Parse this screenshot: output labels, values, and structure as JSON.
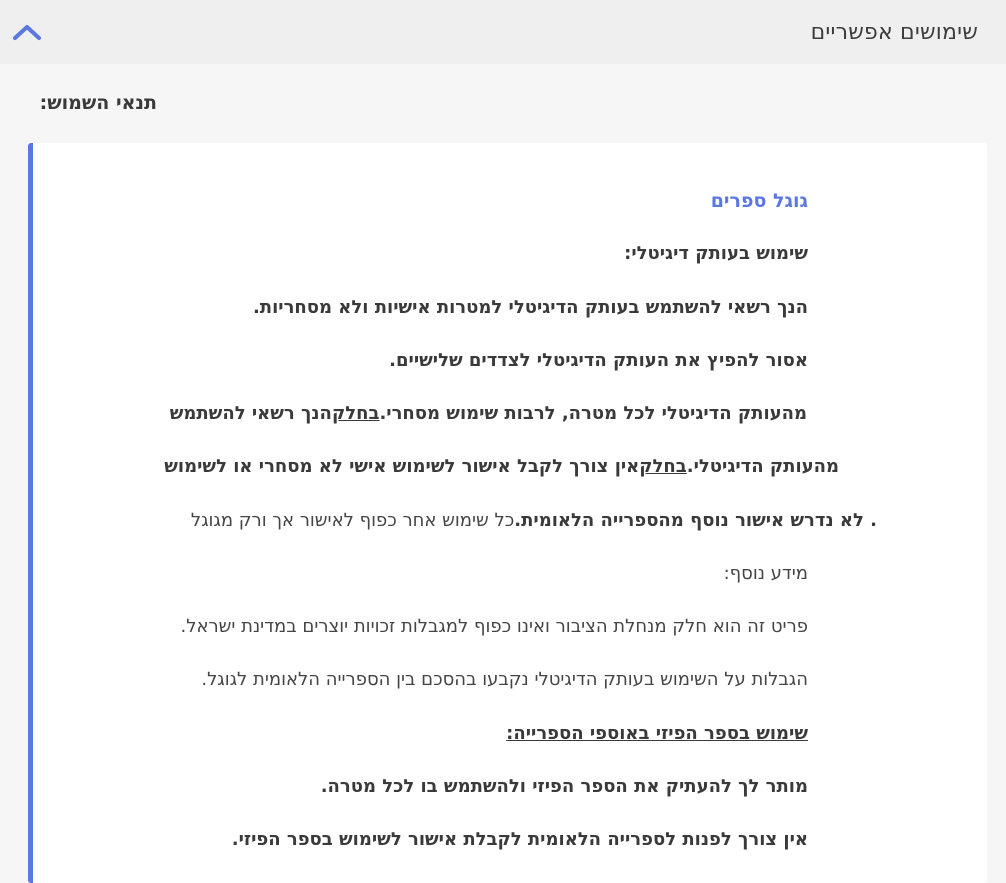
{
  "header": {
    "title": "שימושים אפשריים",
    "toggle_icon": "chevron-up-icon",
    "accent_color": "#5b77e3"
  },
  "terms_heading": "תנאי השמוש:",
  "card": {
    "source": "גוגל ספרים",
    "digital_heading": "שימוש בעותק דיגיטלי:",
    "line1": "הנך רשאי להשתמש בעותק הדיגיטלי למטרות אישיות ולא מסחריות.",
    "line2": "אסור להפיץ את העותק הדיגיטלי לצדדים שלישיים.",
    "line3_a": "מהעותק הדיגיטלי לכל מטרה, לרבות שימוש מסחרי.",
    "line3_u": "בחלק",
    "line3_b": "הנך רשאי להשתמש",
    "line4_a": "מהעותק הדיגיטלי.",
    "line4_u": "בחלק",
    "line4_b": "אין צורך לקבל אישור לשימוש אישי לא מסחרי או לשימוש",
    "line5_bold": " . לא נדרש אישור נוסף מהספרייה הלאומית.",
    "line5_normal": "כל שימוש אחר כפוף לאישור אך ורק מגוגל",
    "more_info_label": "מידע נוסף:",
    "info1": "פריט זה הוא חלק מנחלת הציבור ואינו כפוף למגבלות זכויות יוצרים במדינת ישראל.",
    "info2": "הגבלות על השימוש בעותק הדיגיטלי נקבעו בהסכם בין הספרייה הלאומית לגוגל.",
    "physical_heading": "שימוש בספר הפיזי באוספי הספרייה:",
    "physical1": "מותר לך להעתיק את הספר הפיזי ולהשתמש בו לכל מטרה.",
    "physical2": "אין צורך לפנות לספרייה הלאומית לקבלת אישור לשימוש בספר הפיזי."
  }
}
